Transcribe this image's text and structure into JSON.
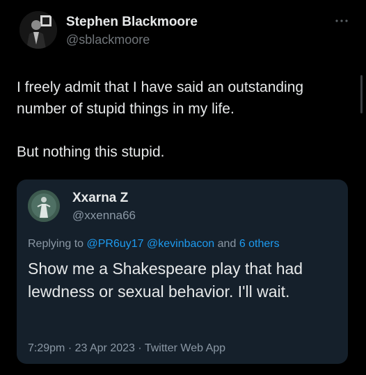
{
  "author": {
    "name": "Stephen Blackmoore",
    "handle": "@sblackmoore"
  },
  "tweet": {
    "paragraphs": [
      "I freely admit that I have said an outstanding number of stupid things in my life.",
      "But nothing this stupid."
    ]
  },
  "quoted": {
    "name": "Xxarna Z",
    "handle": "@xxenna66",
    "reply": {
      "prefix": "Replying to",
      "mention_1": "@PR6uy17",
      "mention_2": "@kevinbacon",
      "joiner": "and",
      "others": "6 others"
    },
    "text": "Show me a Shakespeare play that had lewdness or sexual behavior. I'll wait.",
    "meta": {
      "time": "7:29pm",
      "sep_1": "·",
      "date": "23 Apr 2023",
      "sep_2": "·",
      "source": "Twitter Web App"
    }
  },
  "icons": {
    "more": "more-icon",
    "avatar": "avatar"
  },
  "colors": {
    "background": "#000000",
    "card": "#15202b",
    "text": "#e7e9ea",
    "muted": "#71767b",
    "link": "#1d9bf0"
  }
}
